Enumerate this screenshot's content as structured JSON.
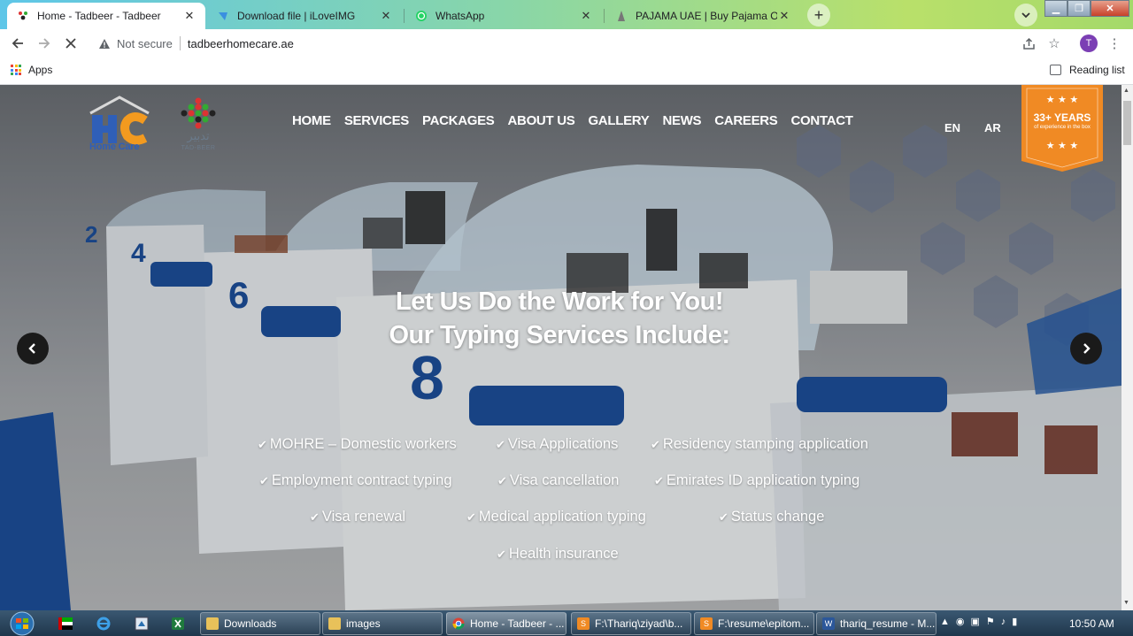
{
  "browser": {
    "tabs": [
      {
        "title": "Home - Tadbeer - Tadbeer",
        "active": true
      },
      {
        "title": "Download file | iLoveIMG",
        "active": false
      },
      {
        "title": "WhatsApp",
        "active": false
      },
      {
        "title": "PAJAMA UAE | Buy Pajama Online",
        "active": false
      }
    ],
    "address": {
      "security_label": "Not secure",
      "url": "tadbeerhomecare.ae"
    },
    "profile_initial": "T",
    "bookmarks": {
      "apps_label": "Apps",
      "reading_list_label": "Reading list"
    }
  },
  "site": {
    "logo_hc": {
      "text": "Home Care"
    },
    "logo_tadbeer": {
      "arabic": "تدبير",
      "latin": "TAD-BEER"
    },
    "nav": [
      "HOME",
      "SERVICES",
      "PACKAGES",
      "ABOUT US",
      "GALLERY",
      "NEWS",
      "CAREERS",
      "CONTACT"
    ],
    "lang": {
      "en": "EN",
      "ar": "AR"
    },
    "badge": {
      "title": "33+ YEARS",
      "subtitle": "of experience in the box"
    },
    "hero": {
      "line1": "Let Us Do the Work for You!",
      "line2": "Our Typing Services Include:",
      "services": [
        "MOHRE – Domestic workers",
        "Visa Applications",
        "Residency stamping application",
        "Employment contract typing",
        "Visa cancellation",
        "Emirates ID application typing",
        "Visa renewal",
        "Medical application typing",
        "Status change",
        "Health insurance"
      ],
      "check_glyph": "✔"
    }
  },
  "taskbar": {
    "tasks": [
      {
        "label": "Downloads"
      },
      {
        "label": "images"
      },
      {
        "label": "Home - Tadbeer - ..."
      },
      {
        "label": "F:\\Thariq\\ziyad\\b..."
      },
      {
        "label": "F:\\resume\\epitom..."
      },
      {
        "label": "thariq_resume - M..."
      }
    ],
    "clock": "10:50 AM"
  },
  "colors": {
    "accent_orange": "#f08a24",
    "logo_blue": "#2f5fb8",
    "logo_orange": "#f39a1f",
    "chrome_avatar": "#7b3fb4"
  }
}
